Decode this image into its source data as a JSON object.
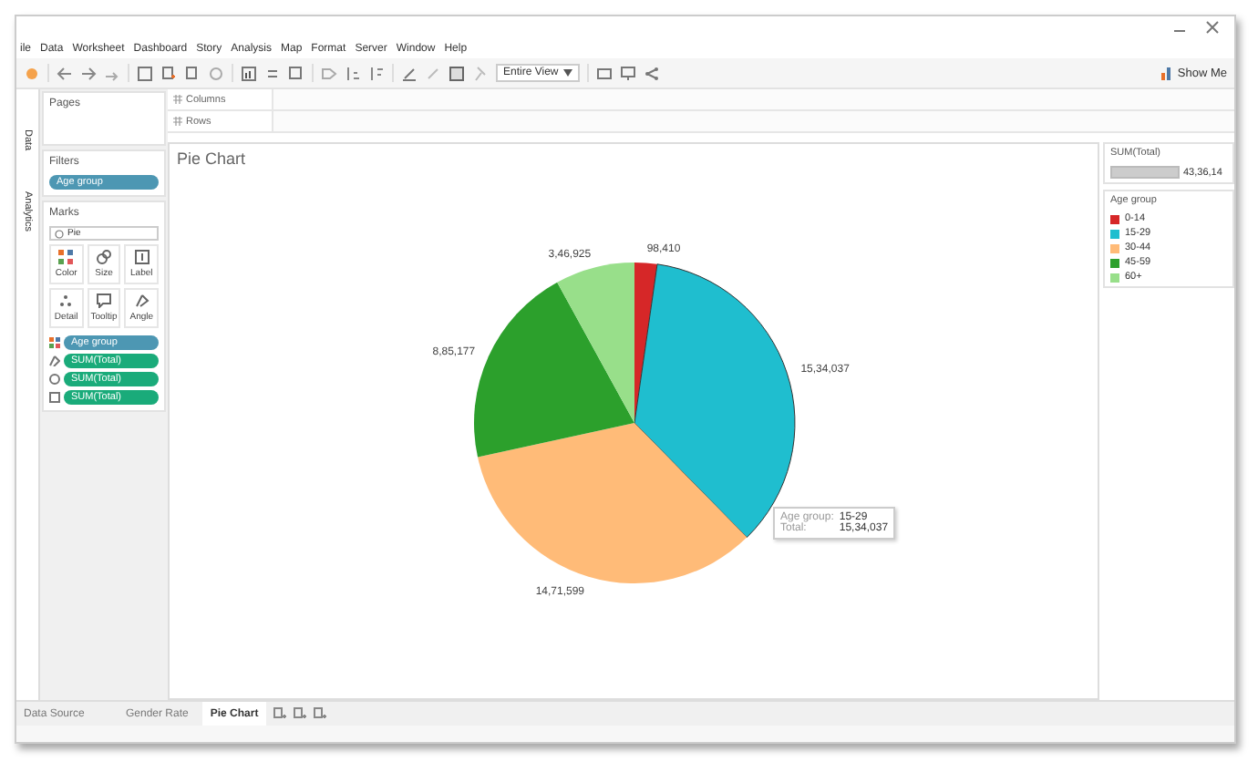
{
  "menu": [
    "ile",
    "Data",
    "Worksheet",
    "Dashboard",
    "Story",
    "Analysis",
    "Map",
    "Format",
    "Server",
    "Window",
    "Help"
  ],
  "toolbar": {
    "fit": "Entire View",
    "show_me": "Show Me"
  },
  "side_tabs": [
    "Data",
    "Analytics"
  ],
  "pages": {
    "title": "Pages"
  },
  "shelves": [
    {
      "label": "Columns"
    },
    {
      "label": "Rows"
    }
  ],
  "filters": {
    "title": "Filters",
    "pills": [
      "Age group"
    ]
  },
  "marks": {
    "title": "Marks",
    "type": "Pie",
    "cards": [
      {
        "kind": "color",
        "label": "Color"
      },
      {
        "kind": "size",
        "label": "Size"
      },
      {
        "kind": "label",
        "label": "Label"
      },
      {
        "kind": "detail",
        "label": "Detail"
      },
      {
        "kind": "tooltip",
        "label": "Tooltip"
      },
      {
        "kind": "angle",
        "label": "Angle"
      }
    ],
    "pills": [
      {
        "kind": "color",
        "color": "#4d97b3",
        "label": "Age group"
      },
      {
        "kind": "angle",
        "color": "#1aab7a",
        "label": "SUM(Total)"
      },
      {
        "kind": "size",
        "color": "#1aab7a",
        "label": "SUM(Total)"
      },
      {
        "kind": "label",
        "color": "#1aab7a",
        "label": "SUM(Total)"
      }
    ]
  },
  "view": {
    "title": "Pie Chart",
    "chart_data": {
      "type": "pie",
      "values": [
        98410,
        1534037,
        1471599,
        885177,
        346925
      ],
      "value_labels": [
        "98,410",
        "15,34,037",
        "14,71,599",
        "8,85,177",
        "3,46,925"
      ]
    },
    "tooltip": {
      "rows": [
        {
          "key": "Age group:",
          "value": "15-29"
        },
        {
          "key": "Total:",
          "value": "15,34,037"
        }
      ]
    }
  },
  "legends": {
    "size": {
      "title": "SUM(Total)",
      "value": "43,36,14"
    },
    "color": {
      "title": "Age group",
      "items": [
        {
          "label": "0-14",
          "color": "#d62728"
        },
        {
          "label": "15-29",
          "color": "#1fbecf"
        },
        {
          "label": "30-44",
          "color": "#ffbb78"
        },
        {
          "label": "45-59",
          "color": "#2ca02c"
        },
        {
          "label": "60+",
          "color": "#98df8a"
        }
      ]
    }
  },
  "sheet_tabs": [
    {
      "kind": "datasource",
      "label": "Data Source",
      "selected": false
    },
    {
      "kind": "sheet",
      "label": "Gender Rate",
      "selected": false
    },
    {
      "kind": "sheet",
      "label": "Pie Chart",
      "selected": true
    }
  ]
}
